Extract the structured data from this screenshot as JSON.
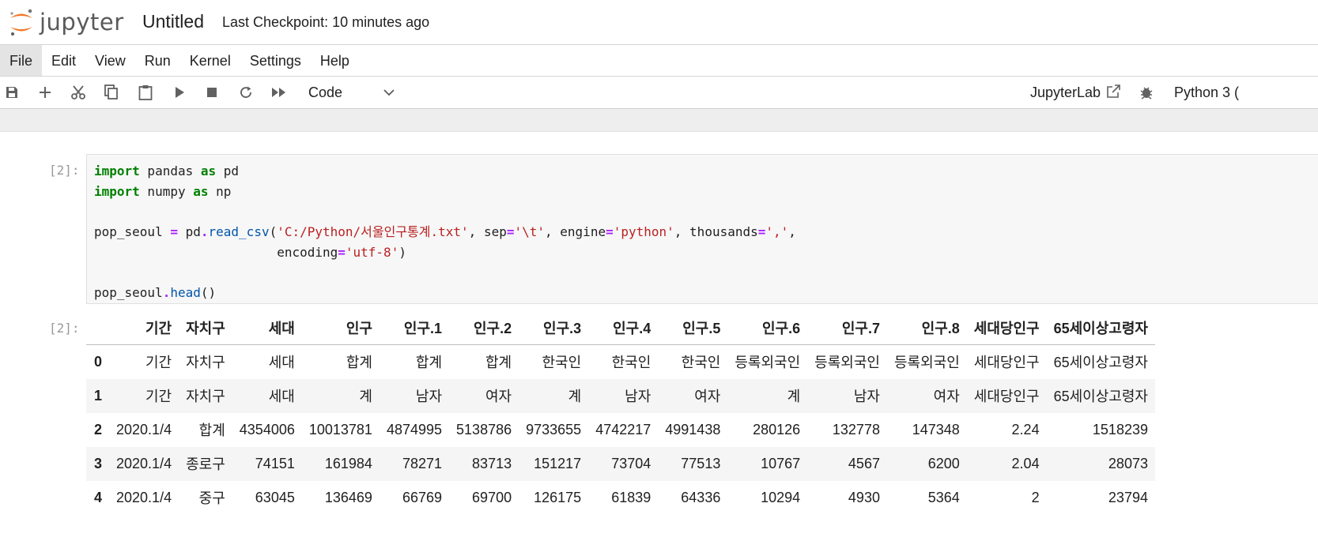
{
  "app": {
    "logo_text": "jupyter",
    "notebook_title": "Untitled",
    "checkpoint": "Last Checkpoint: 10 minutes ago"
  },
  "menu": [
    "File",
    "Edit",
    "View",
    "Run",
    "Kernel",
    "Settings",
    "Help"
  ],
  "toolbar": {
    "icons": [
      "save-icon",
      "add-cell-icon",
      "cut-icon",
      "copy-icon",
      "paste-icon",
      "run-icon",
      "stop-icon",
      "restart-icon",
      "fast-forward-icon"
    ],
    "cell_type": "Code",
    "jupyterlab_label": "JupyterLab",
    "kernel_name": "Python 3 ("
  },
  "cells": {
    "input_prompt": "[2]:",
    "output_prompt": "[2]:"
  },
  "table": {
    "columns": [
      "",
      "기간",
      "자치구",
      "세대",
      "인구",
      "인구.1",
      "인구.2",
      "인구.3",
      "인구.4",
      "인구.5",
      "인구.6",
      "인구.7",
      "인구.8",
      "세대당인구",
      "65세이상고령자"
    ],
    "rows": [
      [
        "0",
        "기간",
        "자치구",
        "세대",
        "합계",
        "합계",
        "합계",
        "한국인",
        "한국인",
        "한국인",
        "등록외국인",
        "등록외국인",
        "등록외국인",
        "세대당인구",
        "65세이상고령자"
      ],
      [
        "1",
        "기간",
        "자치구",
        "세대",
        "계",
        "남자",
        "여자",
        "계",
        "남자",
        "여자",
        "계",
        "남자",
        "여자",
        "세대당인구",
        "65세이상고령자"
      ],
      [
        "2",
        "2020.1/4",
        "합계",
        "4354006",
        "10013781",
        "4874995",
        "5138786",
        "9733655",
        "4742217",
        "4991438",
        "280126",
        "132778",
        "147348",
        "2.24",
        "1518239"
      ],
      [
        "3",
        "2020.1/4",
        "종로구",
        "74151",
        "161984",
        "78271",
        "83713",
        "151217",
        "73704",
        "77513",
        "10767",
        "4567",
        "6200",
        "2.04",
        "28073"
      ],
      [
        "4",
        "2020.1/4",
        "중구",
        "63045",
        "136469",
        "66769",
        "69700",
        "126175",
        "61839",
        "64336",
        "10294",
        "4930",
        "5364",
        "2",
        "23794"
      ]
    ]
  }
}
